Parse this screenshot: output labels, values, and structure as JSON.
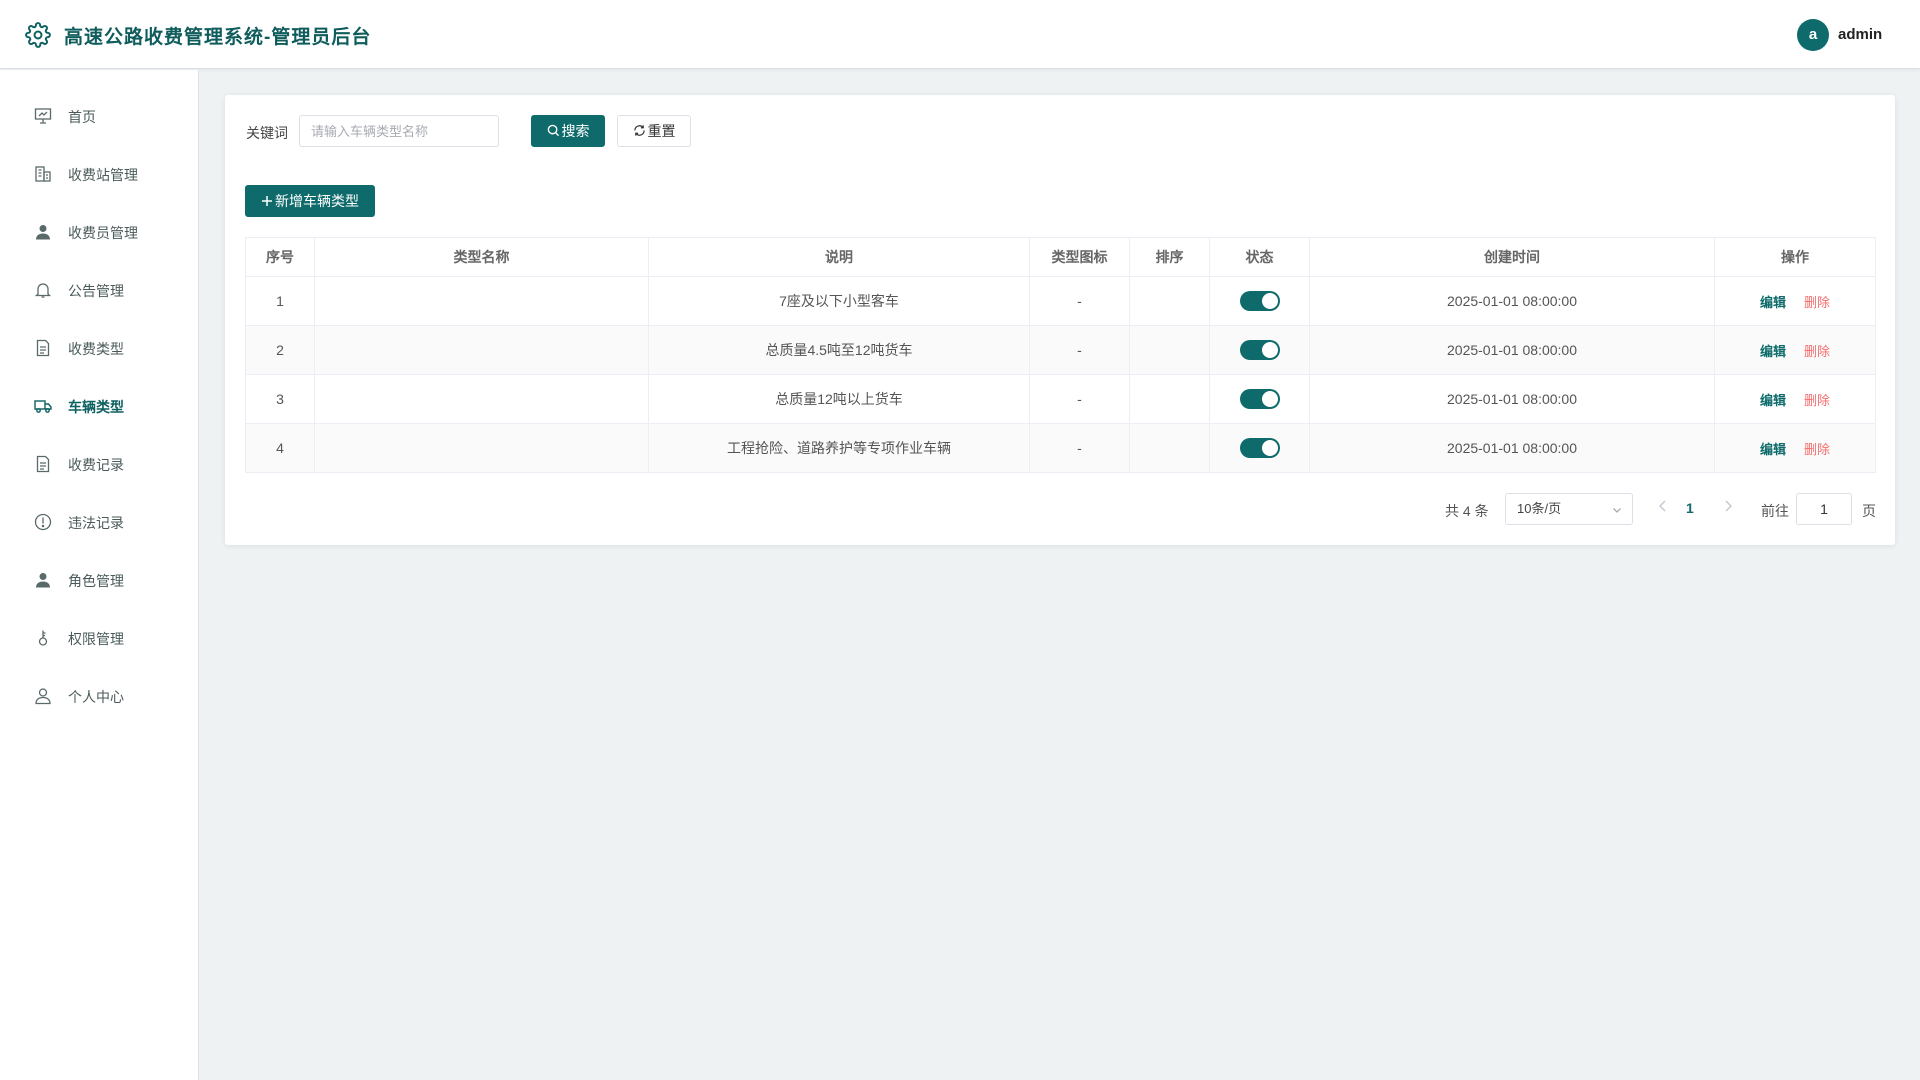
{
  "app": {
    "title": "高速公路收费管理系统-管理员后台"
  },
  "user": {
    "avatar_letter": "a",
    "name": "admin"
  },
  "sidebar": {
    "items": [
      {
        "label": "首页",
        "icon": "dashboard-icon",
        "active": false
      },
      {
        "label": "收费站管理",
        "icon": "building-icon",
        "active": false
      },
      {
        "label": "收费员管理",
        "icon": "user-icon",
        "active": false
      },
      {
        "label": "公告管理",
        "icon": "bell-icon",
        "active": false
      },
      {
        "label": "收费类型",
        "icon": "document-icon",
        "active": false
      },
      {
        "label": "车辆类型",
        "icon": "truck-icon",
        "active": true
      },
      {
        "label": "收费记录",
        "icon": "document-icon",
        "active": false
      },
      {
        "label": "违法记录",
        "icon": "warning-icon",
        "active": false
      },
      {
        "label": "角色管理",
        "icon": "user-icon",
        "active": false
      },
      {
        "label": "权限管理",
        "icon": "key-icon",
        "active": false
      },
      {
        "label": "个人中心",
        "icon": "user-outline-icon",
        "active": false
      }
    ]
  },
  "search": {
    "keyword_label": "关键词",
    "placeholder": "请输入车辆类型名称",
    "value": "",
    "search_label": "搜索",
    "reset_label": "重置"
  },
  "toolbar": {
    "add_label": "新增车辆类型"
  },
  "table": {
    "columns": [
      "序号",
      "类型名称",
      "说明",
      "类型图标",
      "排序",
      "状态",
      "创建时间",
      "操作"
    ],
    "rows": [
      {
        "index": "1",
        "name": "",
        "desc": "7座及以下小型客车",
        "icon": "-",
        "sort": "",
        "enabled": true,
        "created": "2025-01-01 08:00:00"
      },
      {
        "index": "2",
        "name": "",
        "desc": "总质量4.5吨至12吨货车",
        "icon": "-",
        "sort": "",
        "enabled": true,
        "created": "2025-01-01 08:00:00"
      },
      {
        "index": "3",
        "name": "",
        "desc": "总质量12吨以上货车",
        "icon": "-",
        "sort": "",
        "enabled": true,
        "created": "2025-01-01 08:00:00"
      },
      {
        "index": "4",
        "name": "",
        "desc": "工程抢险、道路养护等专项作业车辆",
        "icon": "-",
        "sort": "",
        "enabled": true,
        "created": "2025-01-01 08:00:00"
      }
    ],
    "edit_label": "编辑",
    "delete_label": "删除"
  },
  "pagination": {
    "total_text": "共 4 条",
    "page_size": "10条/页",
    "current_page": "1",
    "goto_label": "前往",
    "goto_value": "1",
    "page_suffix": "页"
  },
  "colors": {
    "accent": "#0f6b6b",
    "danger": "#f56c6c",
    "background": "#eef2f3"
  }
}
